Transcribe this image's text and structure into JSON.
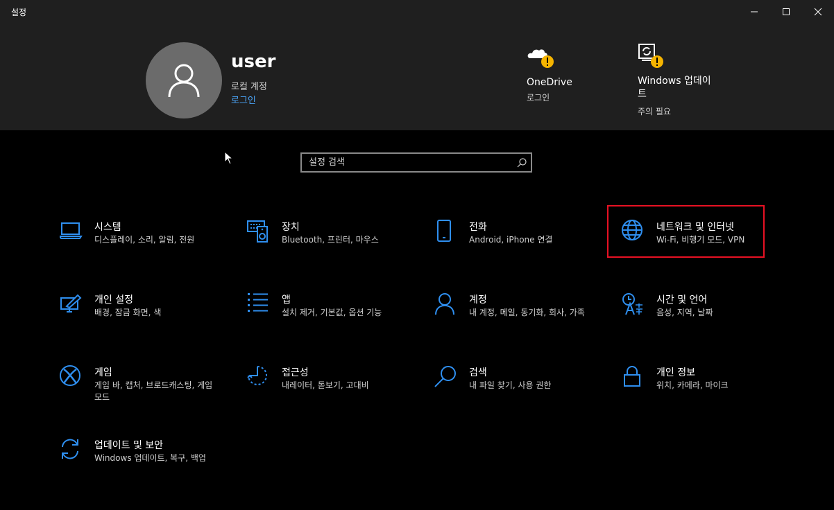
{
  "window": {
    "title": "설정"
  },
  "header": {
    "user": {
      "name": "user",
      "account_type": "로컬 계정",
      "signin_link": "로그인"
    },
    "status": [
      {
        "title": "OneDrive",
        "sub": "로그인",
        "icon": "onedrive-warning-icon"
      },
      {
        "title": "Windows 업데이트",
        "sub": "주의 필요",
        "icon": "update-warning-icon"
      }
    ]
  },
  "search": {
    "placeholder": "설정 검색"
  },
  "categories": [
    {
      "title": "시스템",
      "desc": "디스플레이, 소리, 알림, 전원",
      "icon": "laptop-icon"
    },
    {
      "title": "장치",
      "desc": "Bluetooth, 프린터, 마우스",
      "icon": "devices-icon"
    },
    {
      "title": "전화",
      "desc": "Android, iPhone 연결",
      "icon": "phone-icon"
    },
    {
      "title": "네트워크 및 인터넷",
      "desc": "Wi-Fi, 비행기 모드, VPN",
      "icon": "globe-icon"
    },
    {
      "title": "개인 설정",
      "desc": "배경, 잠금 화면, 색",
      "icon": "personalization-icon"
    },
    {
      "title": "앱",
      "desc": "설치 제거, 기본값, 옵션 기능",
      "icon": "apps-list-icon"
    },
    {
      "title": "계정",
      "desc": "내 계정, 메일, 동기화, 회사, 가족",
      "icon": "person-icon"
    },
    {
      "title": "시간 및 언어",
      "desc": "음성, 지역, 날짜",
      "icon": "time-language-icon"
    },
    {
      "title": "게임",
      "desc": "게임 바, 캡처, 브로드캐스팅, 게임 모드",
      "icon": "xbox-icon"
    },
    {
      "title": "접근성",
      "desc": "내레이터, 돋보기, 고대비",
      "icon": "accessibility-icon"
    },
    {
      "title": "검색",
      "desc": "내 파일 찾기, 사용 권한",
      "icon": "search-icon"
    },
    {
      "title": "개인 정보",
      "desc": "위치, 카메라, 마이크",
      "icon": "lock-icon"
    },
    {
      "title": "업데이트 및 보안",
      "desc": "Windows 업데이트, 복구, 백업",
      "icon": "sync-icon"
    }
  ],
  "colors": {
    "accent": "#2f8ff0",
    "link": "#4aa3f5",
    "highlight_border": "#e81123",
    "warning": "#f5b400"
  }
}
